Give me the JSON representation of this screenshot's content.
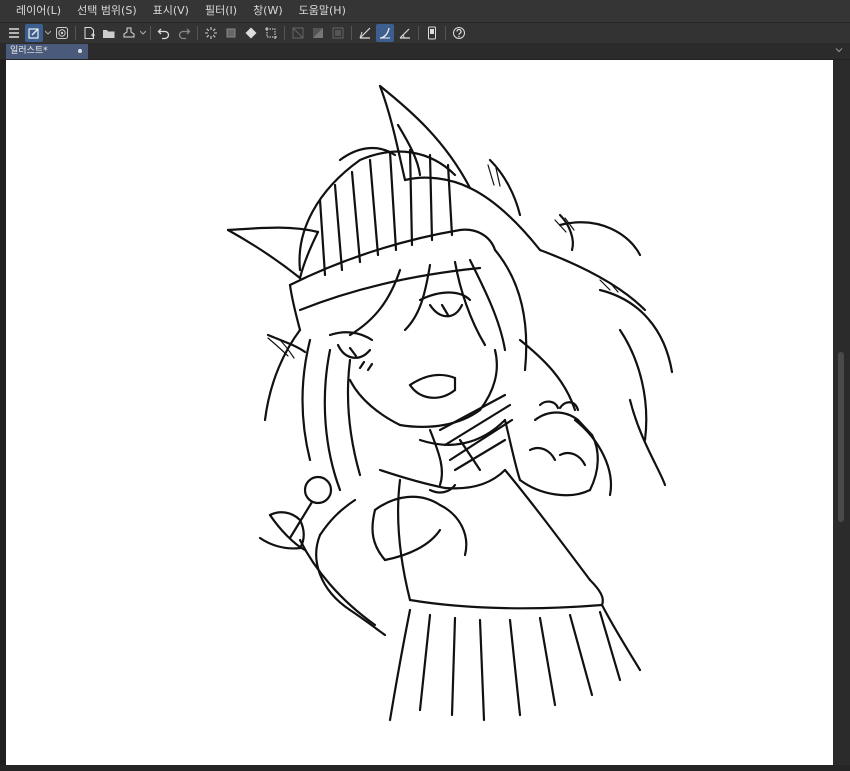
{
  "menu": {
    "items": [
      "레이어(L)",
      "선택 범위(S)",
      "표시(V)",
      "필터(I)",
      "창(W)",
      "도움말(H)"
    ]
  },
  "toolbar": {
    "icons": [
      "hamburger-menu-icon",
      "edit-tool-icon",
      "spiral-icon",
      "new-file-icon",
      "open-folder-icon",
      "save-stamp-icon",
      "undo-icon",
      "redo-icon",
      "selection-sparkle-icon",
      "transform-icon",
      "fill-icon",
      "crop-icon",
      "layer-hide-icon",
      "layer-gradient-icon",
      "layer-frame-icon",
      "ruler-corner-icon",
      "ruler-curve-icon",
      "ruler-angle-icon",
      "device-icon",
      "help-icon"
    ]
  },
  "document": {
    "tab_label": "일러스트*"
  },
  "colors": {
    "menubar": "#353535",
    "toolbar": "#333333",
    "accent": "#3d5f8f",
    "tab": "#4a5a7a",
    "canvas": "#ffffff",
    "ink": "#111111"
  }
}
